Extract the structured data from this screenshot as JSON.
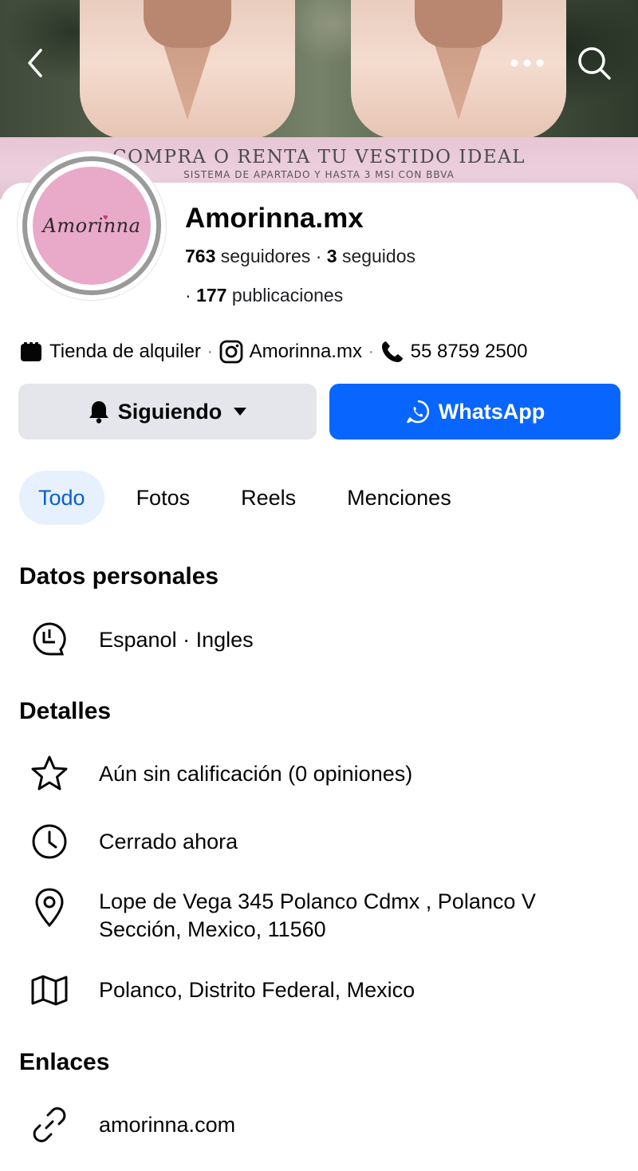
{
  "page": {
    "name": "Amorinna.mx",
    "followers_count": "763",
    "followers_label": "seguidores",
    "following_count": "3",
    "following_label": "seguidos",
    "posts_count": "177",
    "posts_label": "publicaciones",
    "avatar_logo_text": "Amorinna"
  },
  "cover": {
    "banner_title": "COMPRA O RENTA TU VESTIDO IDEAL",
    "banner_subtitle": "SISTEMA DE APARTADO Y HASTA 3 MSI CON BBVA"
  },
  "info": {
    "category": "Tienda de alquiler",
    "instagram": "Amorinna.mx",
    "phone": "55 8759 2500"
  },
  "actions": {
    "following_label": "Siguiendo",
    "whatsapp_label": "WhatsApp"
  },
  "tabs": [
    {
      "label": "Todo",
      "active": true
    },
    {
      "label": "Fotos",
      "active": false
    },
    {
      "label": "Reels",
      "active": false
    },
    {
      "label": "Menciones",
      "active": false
    }
  ],
  "sections": {
    "personal": {
      "title": "Datos personales",
      "languages": "Espanol · Ingles"
    },
    "details": {
      "title": "Detalles",
      "rating": "Aún sin calificación (0 opiniones)",
      "hours": "Cerrado ahora",
      "address_line1": "Lope de Vega 345 Polanco  Cdmx , Polanco V",
      "address_line2": "Sección, Mexico, 11560",
      "area": "Polanco, Distrito Federal, Mexico"
    },
    "links": {
      "title": "Enlaces",
      "website": "amorinna.com"
    }
  },
  "colors": {
    "primary_blue": "#0866ff",
    "active_tab_bg": "#e7f0fd",
    "active_tab_text": "#0a5fcf",
    "secondary_button_bg": "#e4e6eb",
    "avatar_pink": "#e9a9c8"
  },
  "icons": {
    "back": "chevron-left-icon",
    "more": "more-dots-icon",
    "search": "search-icon",
    "category": "shop-icon",
    "instagram": "instagram-icon",
    "phone": "phone-icon",
    "bell": "bell-icon",
    "caret": "caret-down-icon",
    "whatsapp": "whatsapp-icon",
    "languages": "speech-bubble-icon",
    "rating": "star-icon",
    "hours": "clock-icon",
    "address": "location-pin-icon",
    "area": "map-icon",
    "website": "link-icon"
  }
}
